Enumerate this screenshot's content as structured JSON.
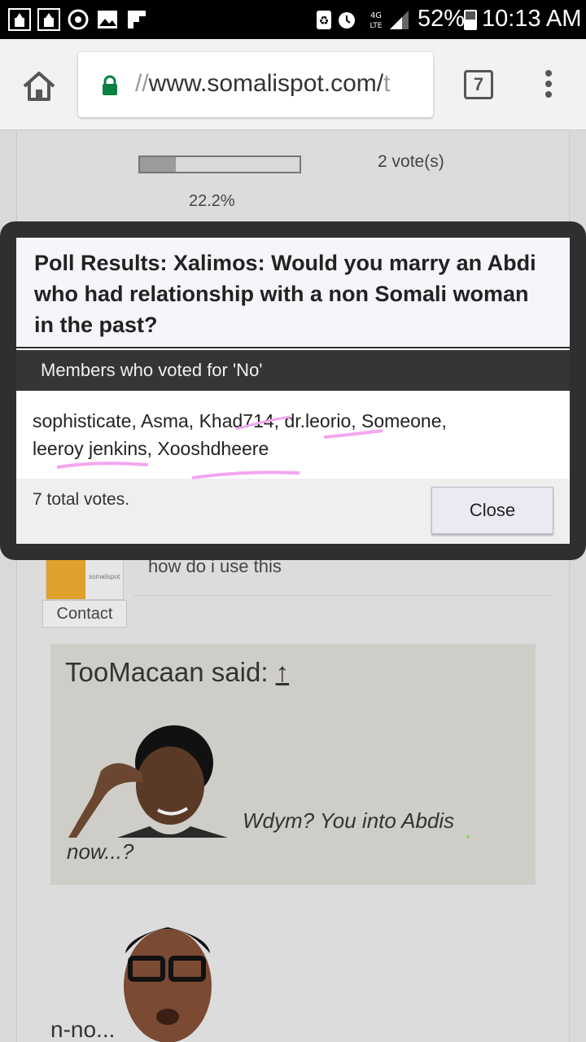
{
  "status_bar": {
    "battery": "52%",
    "time": "10:13 AM",
    "network": "4G LTE",
    "icons": [
      "mosque-icon",
      "mosque-icon",
      "sync-icon",
      "image-icon",
      "flipboard-icon",
      "battery-saver-icon",
      "alarm-icon",
      "network-icon",
      "signal-icon",
      "battery-icon"
    ]
  },
  "browser": {
    "url_prefix": "//",
    "url_main": "www.somalispot.com/",
    "url_suffix": "t",
    "tab_count": "7",
    "icons": [
      "home-icon",
      "lock-icon",
      "tab-switcher-icon",
      "overflow-menu-icon"
    ]
  },
  "background_page": {
    "votes": "2 vote(s)",
    "percent": "22.2%",
    "progress_fraction": 0.222,
    "post_text": "how do i use this",
    "contact_label": "Contact",
    "avatar_logo": "somalispot",
    "quote_title": "TooMacaan said: ",
    "quote_arrow": "↑",
    "quote_line1": "Wdym? You into Abdis",
    "quote_line2": "now...?",
    "reply_text": "n-no..."
  },
  "modal": {
    "title": "Poll Results: Xalimos: Would you marry an Abdi who had relationship with a non Somali woman in the past?",
    "subheader": "Members who voted for 'No'",
    "voters": [
      "sophisticate",
      "Asma",
      "Khad714",
      "dr.leorio",
      "Someone",
      "leeroy jenkins",
      "Xooshdheere"
    ],
    "total_votes": "7 total votes.",
    "close_label": "Close"
  },
  "colors": {
    "status_bar": "#000000",
    "toolbar": "#f2f2f2",
    "lock_green": "#0b8043",
    "modal_frame": "#2f2f2f",
    "annotation_pink": "#f4a6f0"
  }
}
